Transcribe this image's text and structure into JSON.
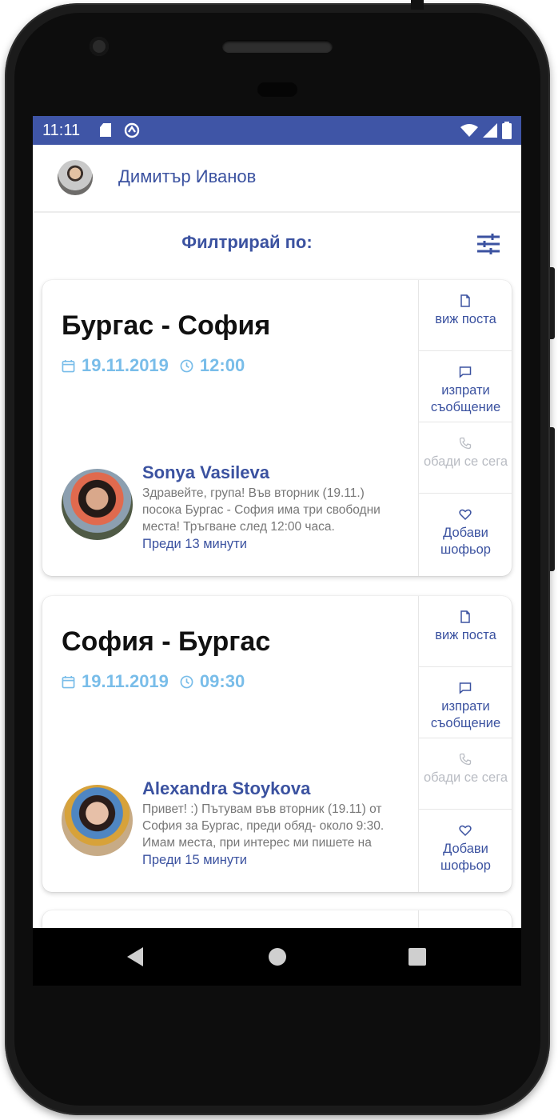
{
  "status_bar": {
    "time": "11:11",
    "icons": [
      "sd-card-icon",
      "sync-icon",
      "wifi-icon",
      "cell-signal-icon",
      "battery-icon"
    ],
    "color": "#3f55a6"
  },
  "header": {
    "user_name": "Димитър Иванов"
  },
  "filter": {
    "label": "Филтрирай по:",
    "icon": "tune-icon"
  },
  "colors": {
    "accent": "#3b52a0",
    "date_blue": "#79bde9",
    "muted": "#b9bcc3"
  },
  "posts": [
    {
      "route": "Бургас - София",
      "date": "19.11.2019",
      "time": "12:00",
      "author": "Sonya Vasileva",
      "message": "Здравейте, група! Във вторник (19.11.) посока Бургас - София има три свободни места! Тръгване след 12:00 часа.",
      "posted": "Преди 13 минути",
      "actions": {
        "view": "виж поста",
        "message": "изпрати съобщение",
        "call": "обади се сега",
        "add": "Добави шофьор"
      }
    },
    {
      "route": "София - Бургас",
      "date": "19.11.2019",
      "time": "09:30",
      "author": "Alexandra Stoykova",
      "message": "Привет! :) Пътувам във вторник (19.11) от София за Бургас, преди обяд- около 9:30. Имам места, при интерес ми пишете на",
      "posted": "Преди 15 минути",
      "actions": {
        "view": "виж поста",
        "message": "изпрати съобщение",
        "call": "обади се сега",
        "add": "Добави шофьор"
      }
    }
  ],
  "nav": {
    "icons": [
      "back-icon",
      "home-icon",
      "recents-icon"
    ]
  }
}
